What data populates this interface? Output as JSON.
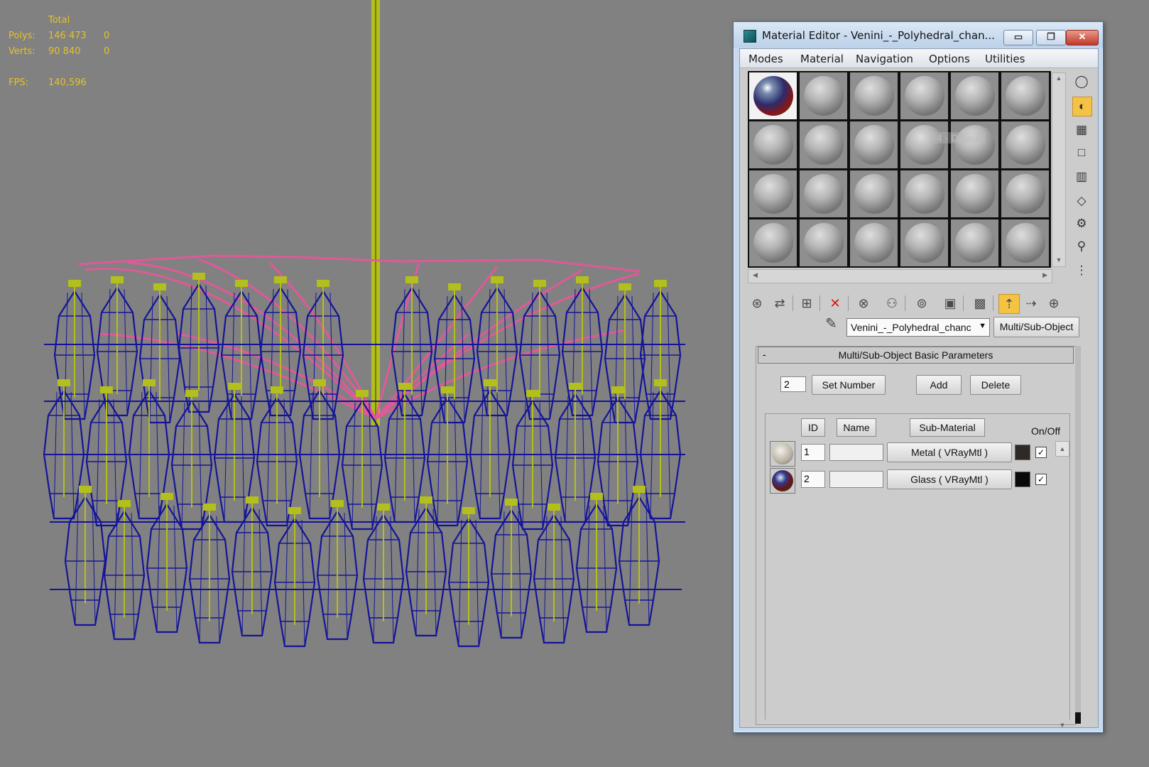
{
  "viewport": {
    "stats": {
      "header": "Total",
      "polys_label": "Polys:",
      "polys_value": "146 473",
      "polys_sel": "0",
      "verts_label": "Verts:",
      "verts_value": "90 840",
      "verts_sel": "0",
      "fps_label": "FPS:",
      "fps_value": "140,596"
    },
    "colors": {
      "background": "#818181",
      "wire_blue": "#14149a",
      "wire_olive": "#b2bf1c",
      "wire_pink": "#e6579a",
      "stats_text": "#e6c12a"
    }
  },
  "material_editor": {
    "title": "Material Editor - Venini_-_Polyhedral_chan...",
    "window_buttons": {
      "minimize": "▭",
      "maximize": "❐",
      "close": "✕"
    },
    "menu": [
      "Modes",
      "Material",
      "Navigation",
      "Options",
      "Utilities"
    ],
    "slot_tooltip": "4 - Default",
    "material_name": "Venini_-_Polyhedral_chanc",
    "material_type": "Multi/Sub-Object",
    "rollout": {
      "title": "Multi/Sub-Object Basic Parameters",
      "collapse": "-",
      "count": "2",
      "set_number": "Set Number",
      "add": "Add",
      "delete": "Delete",
      "col_id": "ID",
      "col_name": "Name",
      "col_sub_material": "Sub-Material",
      "col_on_off": "On/Off",
      "rows": [
        {
          "id": "1",
          "name": "",
          "sub_material": "Metal  ( VRayMtl )",
          "swatch": "#2e2a27",
          "on": "✓"
        },
        {
          "id": "2",
          "name": "",
          "sub_material": "Glass  ( VRayMtl )",
          "swatch": "#0a0a0a",
          "on": "✓"
        }
      ]
    },
    "icons": {
      "sidetools": [
        "sample-type-icon",
        "backlight-icon",
        "background-checker-icon",
        "sample-uv-tiling-icon",
        "video-color-check-icon",
        "make-preview-icon",
        "options-icon",
        "select-by-material-icon",
        "material-map-navigator-icon"
      ],
      "toolbar": [
        "get-material-icon",
        "put-to-scene-icon",
        "assign-to-selection-icon",
        "reset-map-icon",
        "make-unique-icon",
        "put-to-library-icon",
        "material-id-channel-icon",
        "show-shaded-map-icon",
        "show-end-result-icon",
        "go-to-parent-icon",
        "go-forward-sibling-icon",
        "pick-material-icon"
      ]
    }
  }
}
